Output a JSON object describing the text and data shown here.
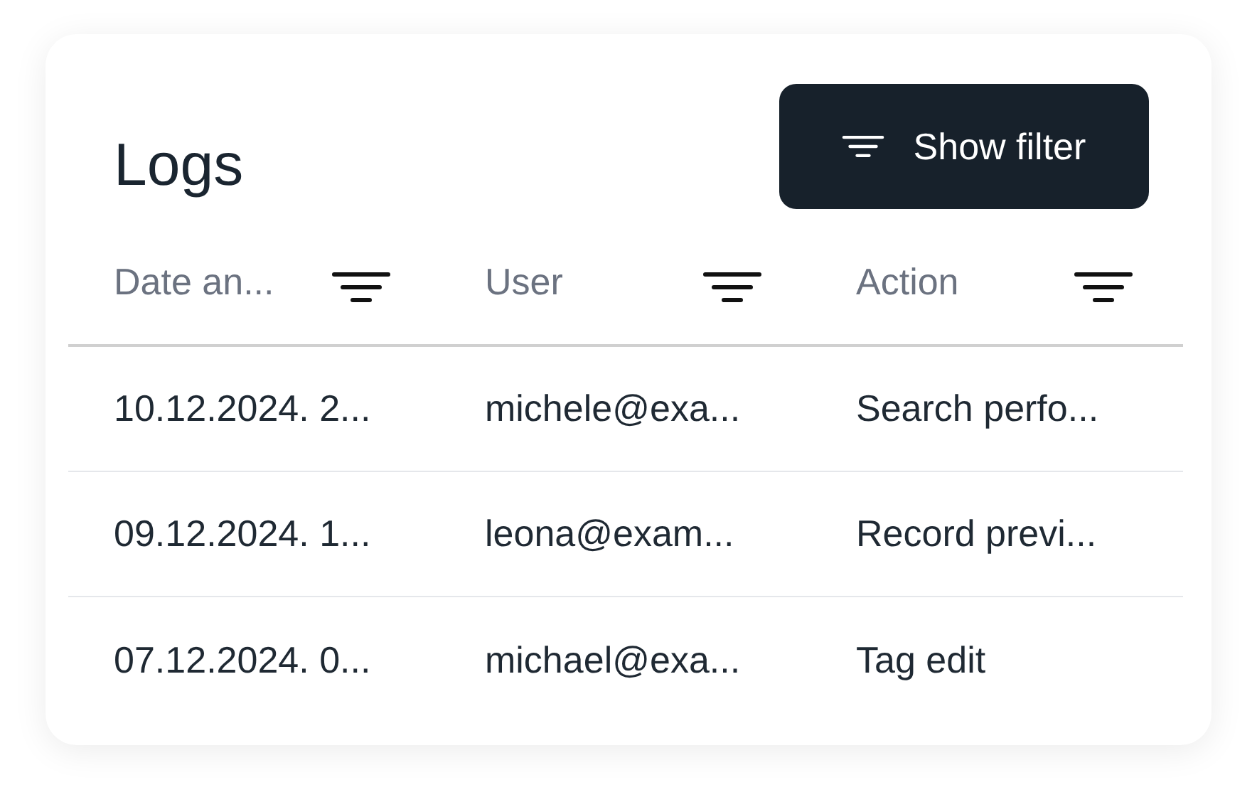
{
  "title": "Logs",
  "filter_button": {
    "label": "Show filter"
  },
  "table": {
    "columns": [
      "Date an...",
      "User",
      "Action"
    ],
    "rows": [
      [
        "10.12.2024. 2...",
        "michele@exa...",
        "Search perfo..."
      ],
      [
        "09.12.2024. 1...",
        "leona@exam...",
        "Record previ..."
      ],
      [
        "07.12.2024. 0...",
        "michael@exa...",
        "Tag edit"
      ]
    ]
  }
}
